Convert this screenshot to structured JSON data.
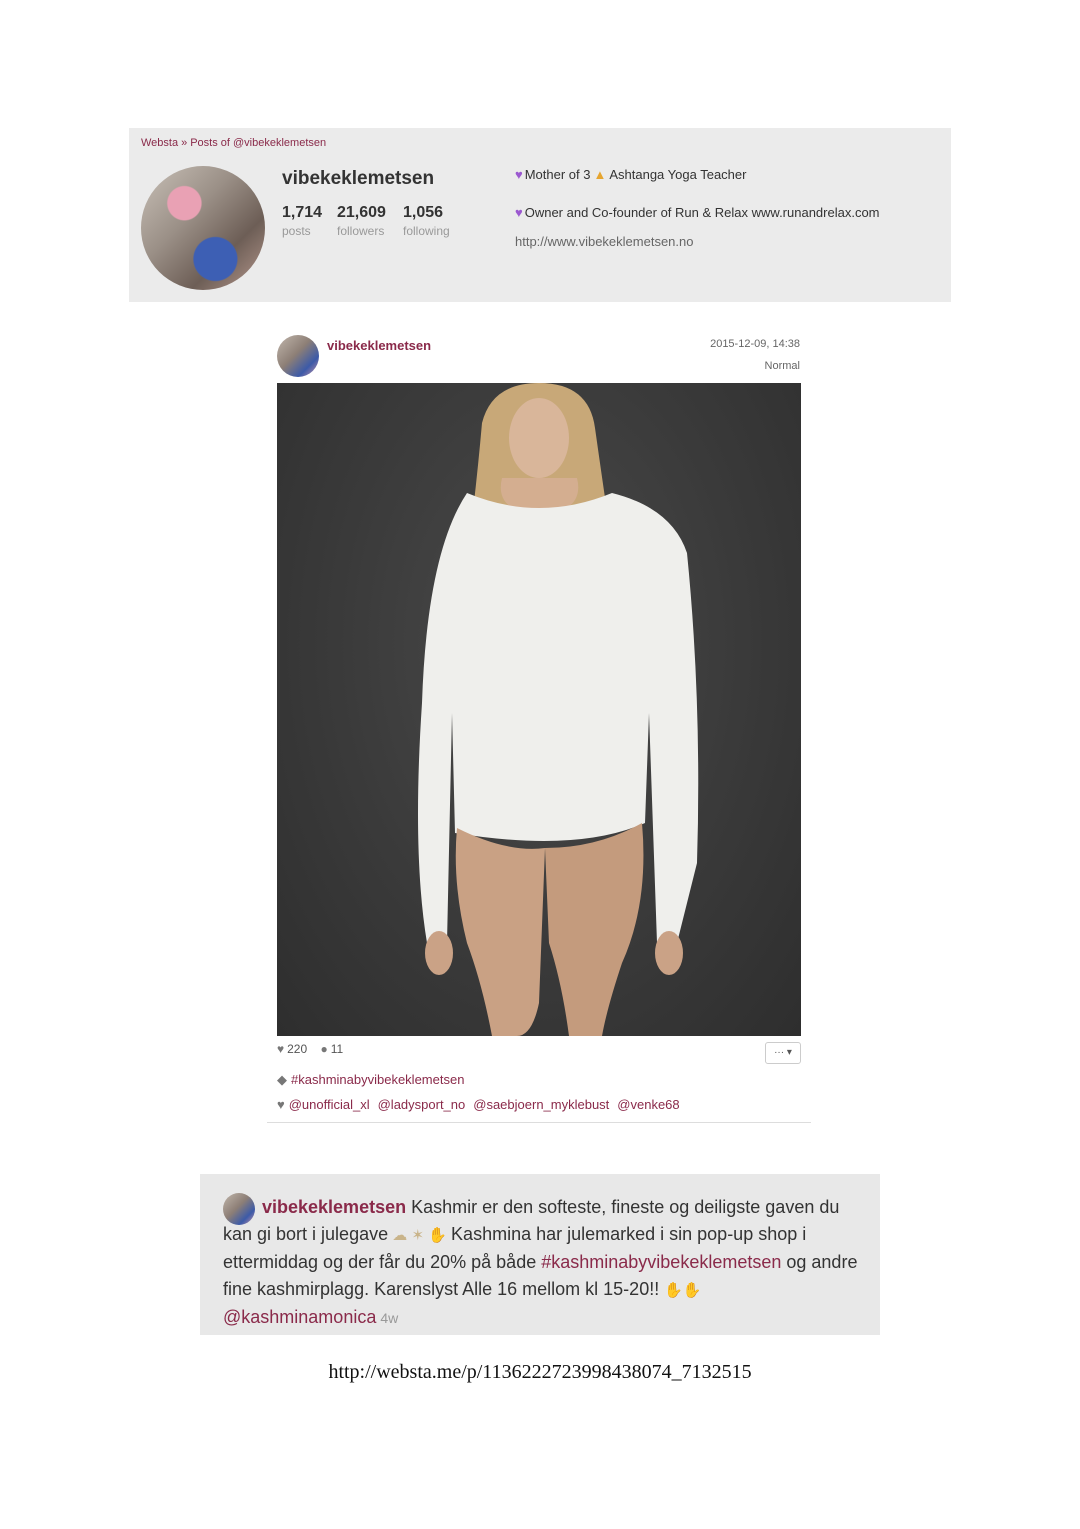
{
  "breadcrumb": {
    "site": "Websta",
    "separator": "»",
    "page": "Posts of @vibekeklemetsen"
  },
  "profile": {
    "username": "vibekeklemetsen",
    "stats": {
      "posts": {
        "value": "1,714",
        "label": "posts"
      },
      "followers": {
        "value": "21,609",
        "label": "followers"
      },
      "following": {
        "value": "1,056",
        "label": "following"
      }
    },
    "bio_line_1_a": "Mother of 3",
    "bio_line_1_b": "Ashtanga Yoga Teacher",
    "bio_line_2": "Owner and Co-founder of Run & Relax www.runandrelax.com",
    "website": "http://www.vibekeklemetsen.no"
  },
  "post": {
    "username": "vibekeklemetsen",
    "date": "2015-12-09, 14:38",
    "filter": "Normal",
    "likes": "220",
    "comments": "11",
    "more_label": "··· ▾",
    "hashtag": "#kashminabyvibekeklemetsen",
    "mentions": [
      "@unofficial_xl",
      "@ladysport_no",
      "@saebjoern_myklebust",
      "@venke68"
    ]
  },
  "caption": {
    "username": "vibekeklemetsen",
    "text_1": "Kashmir er den softeste, fineste og deiligste gaven du kan gi bort i julegave",
    "text_2": "Kashmina har julemarked i sin pop-up shop i ettermiddag og der får du 20% på både",
    "hashtag": "#kashminabyvibekeklemetsen",
    "text_3": "og andre fine kashmirplagg. Karenslyst Alle 16 mellom kl 15-20!!",
    "mention": "@kashminamonica",
    "time": "4w"
  },
  "source_url": "http://websta.me/p/1136222723998438074_7132515",
  "colors": {
    "accent": "#8a2a4a",
    "header_bg": "#ebebeb",
    "caption_bg": "#e8e8e8",
    "photo_bg": "#3a3a3a"
  },
  "icons": [
    "heart-icon",
    "comment-icon",
    "tag-icon",
    "purple-heart-icon",
    "pray-icon",
    "cloud-icon",
    "dizzy-icon",
    "ok-hand-icon",
    "raised-hands-icon"
  ]
}
